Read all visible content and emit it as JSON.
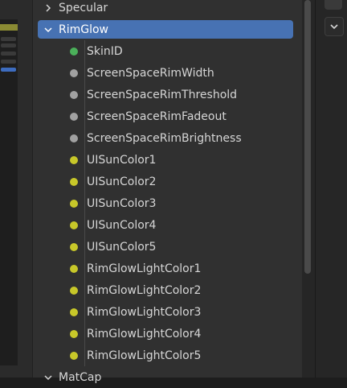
{
  "colors": {
    "socket_green": "#4bb05a",
    "socket_gray": "#a1a1a1",
    "socket_yellow": "#c7c729",
    "selection_blue": "#4772b3"
  },
  "tree": {
    "specular": {
      "label": "Specular",
      "icon": "chevron-right-icon"
    },
    "rimglow": {
      "label": "RimGlow",
      "icon": "chevron-down-icon",
      "expanded": true
    },
    "rimglow_items": [
      {
        "label": "SkinID",
        "socket": "green"
      },
      {
        "label": "ScreenSpaceRimWidth",
        "socket": "gray"
      },
      {
        "label": "ScreenSpaceRimThreshold",
        "socket": "gray"
      },
      {
        "label": "ScreenSpaceRimFadeout",
        "socket": "gray"
      },
      {
        "label": "ScreenSpaceRimBrightness",
        "socket": "gray"
      },
      {
        "label": "UISunColor1",
        "socket": "yellow"
      },
      {
        "label": "UISunColor2",
        "socket": "yellow"
      },
      {
        "label": "UISunColor3",
        "socket": "yellow"
      },
      {
        "label": "UISunColor4",
        "socket": "yellow"
      },
      {
        "label": "UISunColor5",
        "socket": "yellow"
      },
      {
        "label": "RimGlowLightColor1",
        "socket": "yellow"
      },
      {
        "label": "RimGlowLightColor2",
        "socket": "yellow"
      },
      {
        "label": "RimGlowLightColor3",
        "socket": "yellow"
      },
      {
        "label": "RimGlowLightColor4",
        "socket": "yellow"
      },
      {
        "label": "RimGlowLightColor5",
        "socket": "yellow"
      }
    ],
    "matcap": {
      "label": "MatCap",
      "icon": "chevron-down-icon"
    }
  },
  "right_strip": {
    "dropdown_icon": "chevron-down-icon"
  }
}
